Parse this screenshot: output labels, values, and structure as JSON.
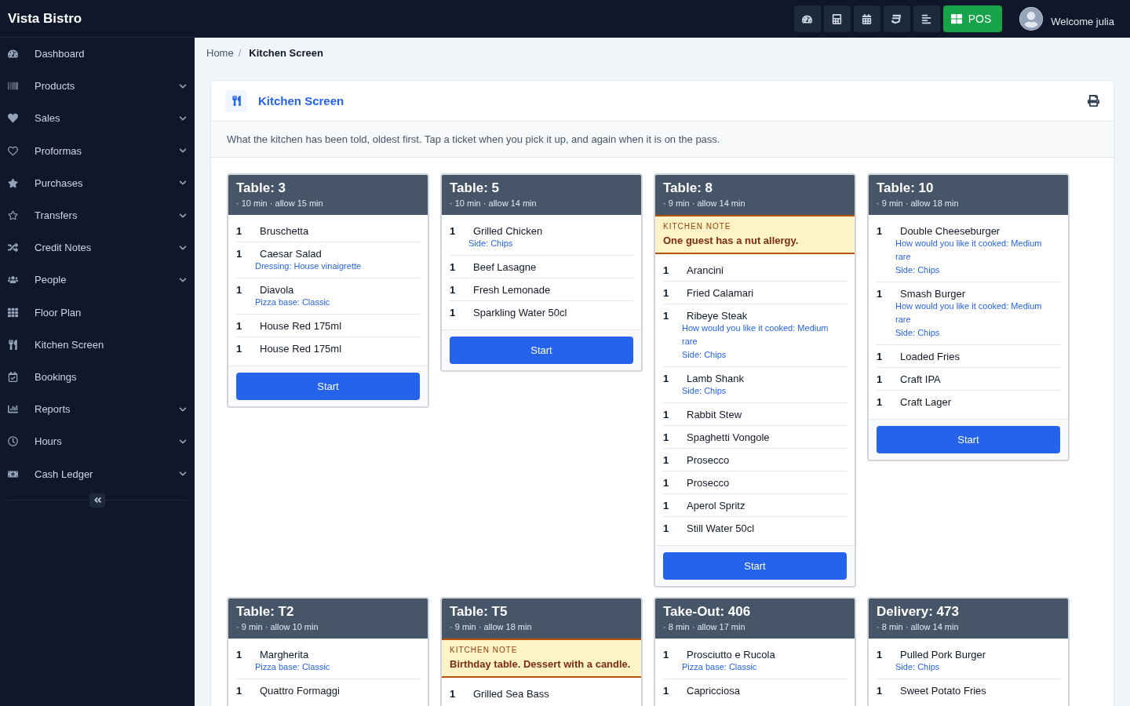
{
  "app": {
    "brand": "Vista Bistro"
  },
  "topbar": {
    "pos_label": "POS",
    "greeting": "Welcome julia"
  },
  "sidebar": {
    "items": [
      {
        "label": "Dashboard",
        "has_submenu": false
      },
      {
        "label": "Products",
        "has_submenu": true
      },
      {
        "label": "Sales",
        "has_submenu": true
      },
      {
        "label": "Proformas",
        "has_submenu": true
      },
      {
        "label": "Purchases",
        "has_submenu": true
      },
      {
        "label": "Transfers",
        "has_submenu": true
      },
      {
        "label": "Credit Notes",
        "has_submenu": true
      },
      {
        "label": "People",
        "has_submenu": true
      },
      {
        "label": "Floor Plan",
        "has_submenu": false
      },
      {
        "label": "Kitchen Screen",
        "has_submenu": false
      },
      {
        "label": "Bookings",
        "has_submenu": false
      },
      {
        "label": "Reports",
        "has_submenu": true
      },
      {
        "label": "Hours",
        "has_submenu": true
      },
      {
        "label": "Cash Ledger",
        "has_submenu": true
      }
    ]
  },
  "breadcrumb": {
    "parent": "Home",
    "separator": "/",
    "current": "Kitchen Screen"
  },
  "panel": {
    "title": "Kitchen Screen",
    "description": "What the kitchen has been told, oldest first. Tap a ticket when you pick it up, and again when it is on the pass."
  },
  "tickets": [
    {
      "title": "Table: 3",
      "timing": "· 10 min · allow 15 min",
      "items": [
        {
          "qty": "1",
          "name": "Bruschetta"
        },
        {
          "qty": "1",
          "name": "Caesar Salad",
          "modifiers": [
            "Dressing: House vinaigrette"
          ]
        },
        {
          "qty": "1",
          "name": "Diavola",
          "modifiers": [
            "Pizza base: Classic"
          ]
        },
        {
          "qty": "1",
          "name": "House Red 175ml"
        },
        {
          "qty": "1",
          "name": "House Red 175ml"
        }
      ],
      "button": "Start"
    },
    {
      "title": "Table: 5",
      "timing": "· 10 min · allow 14 min",
      "items": [
        {
          "qty": "1",
          "name": "Grilled Chicken",
          "modifiers": [
            "Side: Chips"
          ]
        },
        {
          "qty": "1",
          "name": "Beef Lasagne"
        },
        {
          "qty": "1",
          "name": "Fresh Lemonade"
        },
        {
          "qty": "1",
          "name": "Sparkling Water 50cl"
        }
      ],
      "button": "Start"
    },
    {
      "title": "Table: 8",
      "timing": "· 9 min · allow 14 min",
      "note": {
        "label": "KITCHEN NOTE",
        "text": "One guest has a nut allergy."
      },
      "items": [
        {
          "qty": "1",
          "name": "Arancini"
        },
        {
          "qty": "1",
          "name": "Fried Calamari"
        },
        {
          "qty": "1",
          "name": "Ribeye Steak",
          "modifiers": [
            "How would you like it cooked: Medium rare",
            "Side: Chips"
          ]
        },
        {
          "qty": "1",
          "name": "Lamb Shank",
          "modifiers": [
            "Side: Chips"
          ]
        },
        {
          "qty": "1",
          "name": "Rabbit Stew"
        },
        {
          "qty": "1",
          "name": "Spaghetti Vongole"
        },
        {
          "qty": "1",
          "name": "Prosecco"
        },
        {
          "qty": "1",
          "name": "Prosecco"
        },
        {
          "qty": "1",
          "name": "Aperol Spritz"
        },
        {
          "qty": "1",
          "name": "Still Water 50cl"
        }
      ],
      "button": "Start"
    },
    {
      "title": "Table: 10",
      "timing": "· 9 min · allow 18 min",
      "items": [
        {
          "qty": "1",
          "name": "Double Cheeseburger",
          "modifiers": [
            "How would you like it cooked: Medium rare",
            "Side: Chips"
          ]
        },
        {
          "qty": "1",
          "name": "Smash Burger",
          "modifiers": [
            "How would you like it cooked: Medium rare",
            "Side: Chips"
          ]
        },
        {
          "qty": "1",
          "name": "Loaded Fries"
        },
        {
          "qty": "1",
          "name": "Craft IPA"
        },
        {
          "qty": "1",
          "name": "Craft Lager"
        }
      ],
      "button": "Start"
    },
    {
      "title": "Table: T2",
      "timing": "· 9 min · allow 10 min",
      "items": [
        {
          "qty": "1",
          "name": "Margherita",
          "modifiers": [
            "Pizza base: Classic"
          ]
        },
        {
          "qty": "1",
          "name": "Quattro Formaggi"
        }
      ]
    },
    {
      "title": "Table: T5",
      "timing": "· 9 min · allow 18 min",
      "note": {
        "label": "KITCHEN NOTE",
        "text": "Birthday table. Dessert with a candle."
      },
      "items": [
        {
          "qty": "1",
          "name": "Grilled Sea Bass"
        }
      ]
    },
    {
      "title": "Take-Out: 406",
      "timing": "· 8 min · allow 17 min",
      "items": [
        {
          "qty": "1",
          "name": "Prosciutto e Rucola",
          "modifiers": [
            "Pizza base: Classic"
          ]
        },
        {
          "qty": "1",
          "name": "Capricciosa"
        }
      ]
    },
    {
      "title": "Delivery: 473",
      "timing": "· 8 min · allow 14 min",
      "items": [
        {
          "qty": "1",
          "name": "Pulled Pork Burger",
          "modifiers": [
            "Side: Chips"
          ]
        },
        {
          "qty": "1",
          "name": "Sweet Potato Fries"
        }
      ]
    }
  ]
}
